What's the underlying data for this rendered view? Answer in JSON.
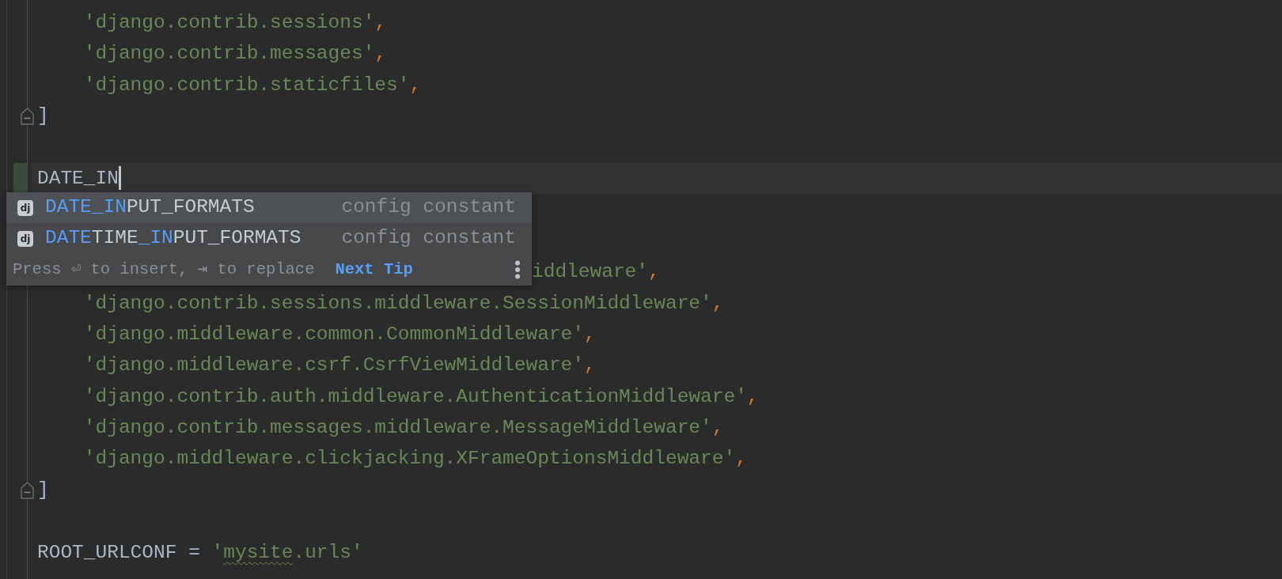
{
  "editor": {
    "lines": [
      {
        "kind": "code",
        "indented": true,
        "tokens": [
          {
            "kind": "string",
            "text": "'django.contrib.sessions'"
          },
          {
            "kind": "punct",
            "text": ","
          }
        ]
      },
      {
        "kind": "code",
        "indented": true,
        "tokens": [
          {
            "kind": "string",
            "text": "'django.contrib.messages'"
          },
          {
            "kind": "punct",
            "text": ","
          }
        ]
      },
      {
        "kind": "code",
        "indented": true,
        "tokens": [
          {
            "kind": "string",
            "text": "'django.contrib.staticfiles'"
          },
          {
            "kind": "punct",
            "text": ","
          }
        ]
      },
      {
        "kind": "code",
        "indented": false,
        "fold": true,
        "tokens": [
          {
            "kind": "ident",
            "text": "]"
          }
        ]
      },
      {
        "kind": "blank"
      },
      {
        "kind": "code",
        "indented": false,
        "current": true,
        "modified": true,
        "tokens": [
          {
            "kind": "ident",
            "text": "DATE_IN"
          }
        ]
      },
      {
        "kind": "blank"
      },
      {
        "kind": "blank"
      },
      {
        "kind": "occluded",
        "tokens": [
          {
            "kind": "string",
            "text": "iddleware'"
          },
          {
            "kind": "punct",
            "text": ","
          }
        ]
      },
      {
        "kind": "code",
        "indented": true,
        "tokens": [
          {
            "kind": "string",
            "text": "'django.contrib.sessions.middleware.SessionMiddleware'"
          },
          {
            "kind": "punct",
            "text": ","
          }
        ]
      },
      {
        "kind": "code",
        "indented": true,
        "tokens": [
          {
            "kind": "string",
            "text": "'django.middleware.common.CommonMiddleware'"
          },
          {
            "kind": "punct",
            "text": ","
          }
        ]
      },
      {
        "kind": "code",
        "indented": true,
        "tokens": [
          {
            "kind": "string",
            "text": "'django.middleware.csrf.CsrfViewMiddleware'"
          },
          {
            "kind": "punct",
            "text": ","
          }
        ]
      },
      {
        "kind": "code",
        "indented": true,
        "tokens": [
          {
            "kind": "string",
            "text": "'django.contrib.auth.middleware.AuthenticationMiddleware'"
          },
          {
            "kind": "punct",
            "text": ","
          }
        ]
      },
      {
        "kind": "code",
        "indented": true,
        "tokens": [
          {
            "kind": "string",
            "text": "'django.contrib.messages.middleware.MessageMiddleware'"
          },
          {
            "kind": "punct",
            "text": ","
          }
        ]
      },
      {
        "kind": "code",
        "indented": true,
        "tokens": [
          {
            "kind": "string",
            "text": "'django.middleware.clickjacking.XFrameOptionsMiddleware'"
          },
          {
            "kind": "punct",
            "text": ","
          }
        ]
      },
      {
        "kind": "code",
        "indented": false,
        "fold": true,
        "tokens": [
          {
            "kind": "ident",
            "text": "]"
          }
        ]
      },
      {
        "kind": "blank"
      },
      {
        "kind": "code",
        "indented": false,
        "tokens": [
          {
            "kind": "ident",
            "text": "ROOT_URLCONF"
          },
          {
            "kind": "ident",
            "text": " = "
          },
          {
            "kind": "string",
            "text": "'"
          },
          {
            "kind": "string",
            "text": "mysite",
            "typo": true
          },
          {
            "kind": "string",
            "text": ".urls'"
          }
        ]
      }
    ]
  },
  "completion": {
    "items": [
      {
        "badge": "dj",
        "selected": true,
        "segments": [
          {
            "text": "DATE_IN",
            "match": true
          },
          {
            "text": "PUT_FORMATS",
            "match": false
          }
        ],
        "type": "config constant"
      },
      {
        "badge": "dj",
        "selected": false,
        "segments": [
          {
            "text": "DATE",
            "match": true
          },
          {
            "text": "TIME",
            "match": false
          },
          {
            "text": "_IN",
            "match": true
          },
          {
            "text": "PUT_FORMATS",
            "match": false
          }
        ],
        "type": "config constant"
      }
    ],
    "hint": "Press ⏎ to insert, ⇥ to replace",
    "tip_link": "Next Tip"
  }
}
